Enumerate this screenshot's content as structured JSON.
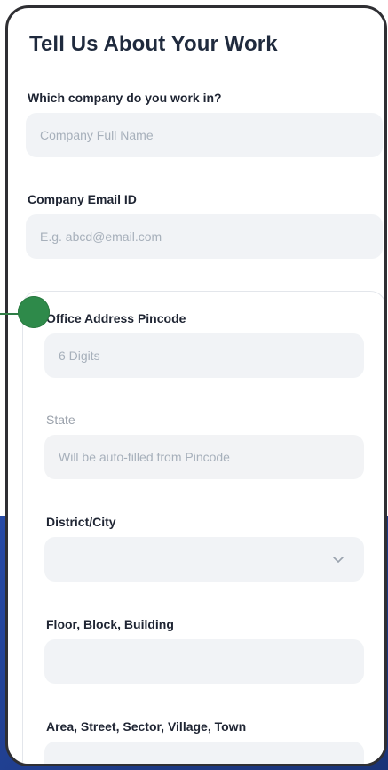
{
  "page": {
    "title": "Tell Us About Your Work"
  },
  "company": {
    "label": "Which company do you work in?",
    "placeholder": "Company Full Name"
  },
  "email": {
    "label": "Company Email ID",
    "placeholder": "E.g. abcd@email.com"
  },
  "address": {
    "pincode_label": "Office Address Pincode",
    "pincode_placeholder": "6 Digits",
    "state_label": "State",
    "state_placeholder": "Will be auto-filled from Pincode",
    "district_label": "District/City",
    "district_value": "",
    "floor_label": "Floor, Block, Building",
    "floor_value": "",
    "area_label": "Area, Street, Sector, Village, Town",
    "area_value": ""
  },
  "icons": {
    "dropdown": "chevron-down-icon"
  },
  "colors": {
    "accent": "#2e8a4a",
    "field_bg": "#f1f3f6",
    "backdrop": "#1f3f8f"
  }
}
